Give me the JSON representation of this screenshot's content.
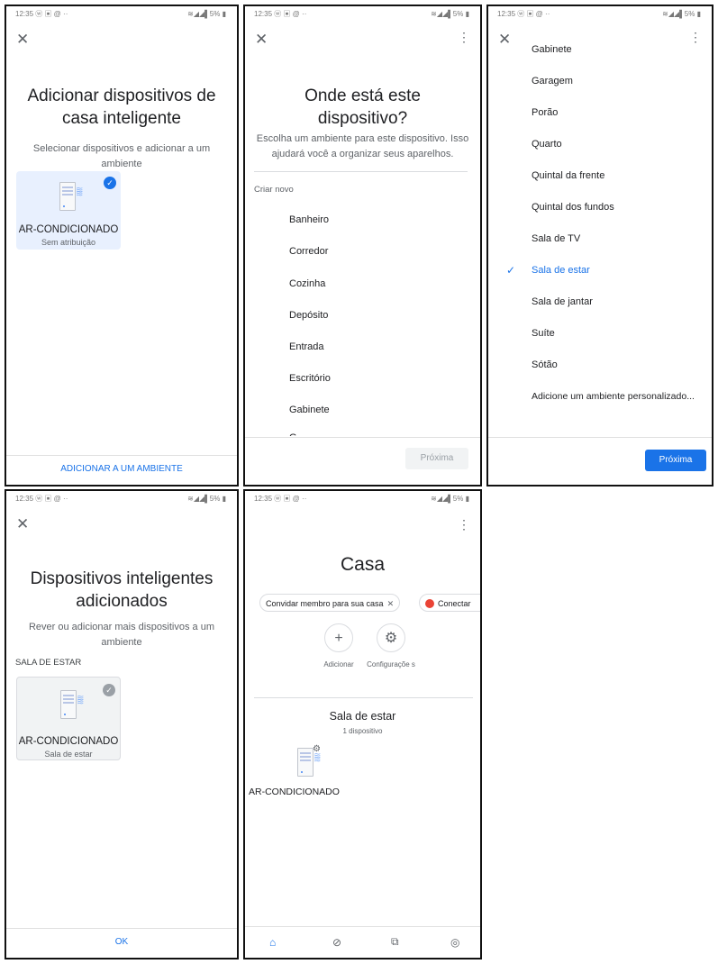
{
  "status_bar": {
    "time": "12:35 ⓦ ▣ @ ··",
    "right": "≋◢◢▌5% ▮"
  },
  "panel1": {
    "title": "Adicionar dispositivos de casa inteligente",
    "subtitle": "Selecionar dispositivos e adicionar a um ambiente",
    "device": {
      "name": "AR-CONDICIONADO",
      "status": "Sem atribuição"
    },
    "bottom_action": "ADICIONAR A UM AMBIENTE"
  },
  "panel2": {
    "title": "Onde está este dispositivo?",
    "subtitle": "Escolha um ambiente para este dispositivo. Isso ajudará você a organizar seus aparelhos.",
    "section_label": "Criar novo",
    "rooms": [
      "Banheiro",
      "Corredor",
      "Cozinha",
      "Depósito",
      "Entrada",
      "Escritório",
      "Gabinete",
      "G"
    ],
    "next_button": "Próxima"
  },
  "panel3": {
    "rooms": [
      "Gabinete",
      "Garagem",
      "Porão",
      "Quarto",
      "Quintal da frente",
      "Quintal dos fundos",
      "Sala de TV",
      "Sala de estar",
      "Sala de jantar",
      "Suíte",
      "Sótão",
      "Adicione um ambiente personalizado..."
    ],
    "selected_room": "Sala de estar",
    "next_button": "Próxima"
  },
  "panel4": {
    "title": "Dispositivos inteligentes adicionados",
    "subtitle": "Rever ou adicionar mais dispositivos a um ambiente",
    "room_header": "SALA DE ESTAR",
    "device": {
      "name": "AR-CONDICIONADO",
      "room": "Sala de estar"
    },
    "ok_button": "OK"
  },
  "panel5": {
    "title": "Casa",
    "chip_invite": "Convidar membro para sua casa",
    "chip_connect": "Conectar",
    "add_label": "Adicionar",
    "settings_label": "Configuraçõe s",
    "room_name": "Sala de estar",
    "room_count": "1 dispositivo",
    "device_name": "AR-CONDICIONADO"
  },
  "colors": {
    "accent": "#1a73e8",
    "card_selected": "#e8f0fe",
    "card_grey": "#f1f3f4",
    "text": "#202124",
    "secondary": "#5f6368"
  },
  "icons": [
    "close-icon",
    "more-vert-icon",
    "check-icon",
    "air-conditioner-icon",
    "plus-icon",
    "gear-icon",
    "home-icon",
    "explore-icon",
    "media-icon",
    "account-icon"
  ]
}
